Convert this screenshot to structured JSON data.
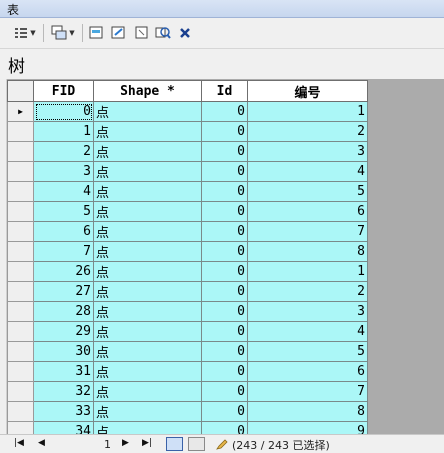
{
  "window": {
    "title": "表"
  },
  "toolbar": {
    "icons": [
      "table-options-icon",
      "related-tables-icon",
      "select-by-attributes-icon",
      "switch-selection-icon",
      "clear-selection-icon",
      "zoom-to-selected-icon",
      "delete-selected-icon"
    ]
  },
  "tab": {
    "label": "树"
  },
  "grid": {
    "columns": [
      "FID",
      "Shape *",
      "Id",
      "编号"
    ],
    "rows": [
      {
        "fid": "0",
        "shape": "点",
        "id": "0",
        "num": "1"
      },
      {
        "fid": "1",
        "shape": "点",
        "id": "0",
        "num": "2"
      },
      {
        "fid": "2",
        "shape": "点",
        "id": "0",
        "num": "3"
      },
      {
        "fid": "3",
        "shape": "点",
        "id": "0",
        "num": "4"
      },
      {
        "fid": "4",
        "shape": "点",
        "id": "0",
        "num": "5"
      },
      {
        "fid": "5",
        "shape": "点",
        "id": "0",
        "num": "6"
      },
      {
        "fid": "6",
        "shape": "点",
        "id": "0",
        "num": "7"
      },
      {
        "fid": "7",
        "shape": "点",
        "id": "0",
        "num": "8"
      },
      {
        "fid": "26",
        "shape": "点",
        "id": "0",
        "num": "1"
      },
      {
        "fid": "27",
        "shape": "点",
        "id": "0",
        "num": "2"
      },
      {
        "fid": "28",
        "shape": "点",
        "id": "0",
        "num": "3"
      },
      {
        "fid": "29",
        "shape": "点",
        "id": "0",
        "num": "4"
      },
      {
        "fid": "30",
        "shape": "点",
        "id": "0",
        "num": "5"
      },
      {
        "fid": "31",
        "shape": "点",
        "id": "0",
        "num": "6"
      },
      {
        "fid": "32",
        "shape": "点",
        "id": "0",
        "num": "7"
      },
      {
        "fid": "33",
        "shape": "点",
        "id": "0",
        "num": "8"
      },
      {
        "fid": "34",
        "shape": "点",
        "id": "0",
        "num": "9"
      }
    ],
    "colors": {
      "selected_row_bg": "#abf7f7",
      "header_bg": "#ffffff",
      "empty_bg": "#ababab"
    }
  },
  "status": {
    "current_record": "1",
    "selection_text": "(243 / 243 已选择)"
  }
}
